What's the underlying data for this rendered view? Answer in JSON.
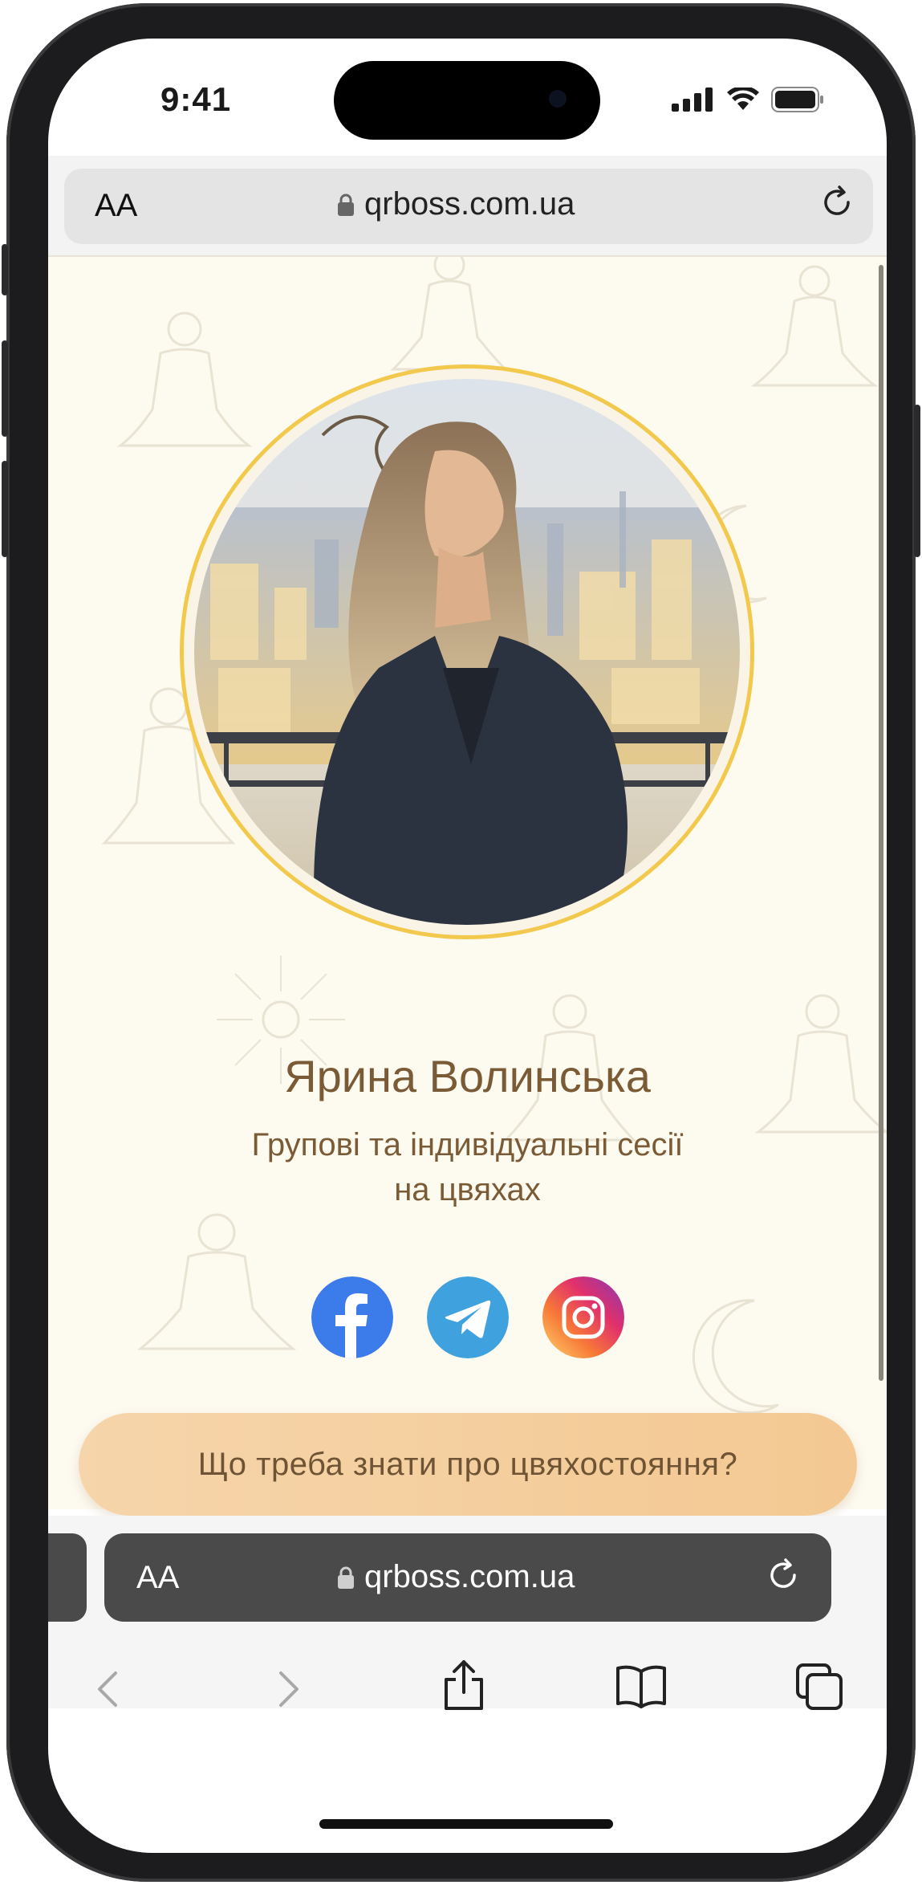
{
  "status_bar": {
    "time": "9:41"
  },
  "browser": {
    "text_size_label": "AA",
    "url": "qrboss.com.ua"
  },
  "profile": {
    "name": "Ярина Волинська",
    "subtitle_line1": "Групові та індивідуальні сесії",
    "subtitle_line2": "на цвяхах"
  },
  "socials": [
    {
      "name": "facebook-icon",
      "color": "#3b7bea"
    },
    {
      "name": "telegram-icon",
      "color": "#3fa2df"
    },
    {
      "name": "instagram-icon",
      "color": "#e1306c"
    }
  ],
  "cta": {
    "label": "Що треба знати про цвяхостояння?"
  },
  "colors": {
    "page_background": "#fdfaf0",
    "accent_gold": "#f2c94c",
    "text_brown": "#7b5a36",
    "cta_peach": "#f4cd9a"
  }
}
